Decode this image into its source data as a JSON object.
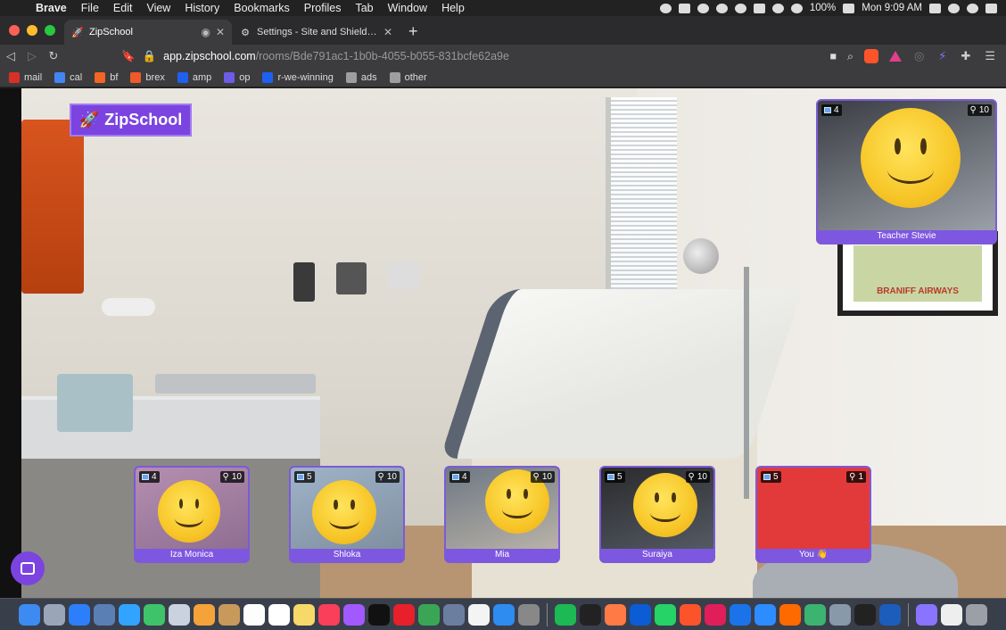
{
  "menubar": {
    "app": "Brave",
    "items": [
      "File",
      "Edit",
      "View",
      "History",
      "Bookmarks",
      "Profiles",
      "Tab",
      "Window",
      "Help"
    ],
    "battery": "100%",
    "clock": "Mon 9:09 AM"
  },
  "tabs": [
    {
      "title": "ZipSchool",
      "active": true,
      "favicon": "rocket-icon"
    },
    {
      "title": "Settings - Site and Shields Setti",
      "active": false,
      "favicon": "gear-icon"
    }
  ],
  "toolbar": {
    "url_host": "app.zipschool.com",
    "url_path": "/rooms/Bde791ac1-1b0b-4055-b055-831bcfe62a9e"
  },
  "bookmarks": [
    {
      "label": "mail",
      "color": "#d93025"
    },
    {
      "label": "cal",
      "color": "#4285f4"
    },
    {
      "label": "bf",
      "color": "#f26522"
    },
    {
      "label": "brex",
      "color": "#f05a28"
    },
    {
      "label": "amp",
      "color": "#1e61f0"
    },
    {
      "label": "op",
      "color": "#6c5ce7"
    },
    {
      "label": "r-we-winning",
      "color": "#1e61f0"
    },
    {
      "label": "ads",
      "color": "#9e9e9e"
    },
    {
      "label": "other",
      "color": "#9e9e9e"
    }
  ],
  "room": {
    "logo_text": "ZipSchool",
    "poster_text": "BRANIFF AIRWAYS"
  },
  "teacher": {
    "name": "Teacher Stevie",
    "left_count": "4",
    "right_count": "10"
  },
  "students": [
    {
      "name": "Iza Monica",
      "left_count": "4",
      "right_count": "10"
    },
    {
      "name": "Shloka",
      "left_count": "5",
      "right_count": "10"
    },
    {
      "name": "Mia",
      "left_count": "4",
      "right_count": "10"
    },
    {
      "name": "Suraiya",
      "left_count": "5",
      "right_count": "10"
    },
    {
      "name": "You 👋",
      "left_count": "5",
      "right_count": "1"
    }
  ],
  "colors": {
    "accent": "#7b44e0",
    "tile_name_bar": "#7e57e0",
    "self_tile_bg": "#e23a3a"
  }
}
